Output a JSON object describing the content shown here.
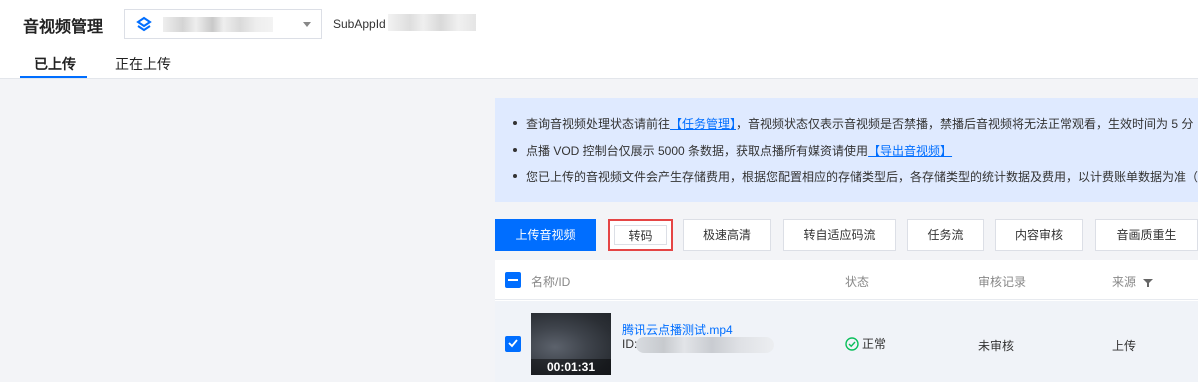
{
  "header": {
    "title": "音视频管理",
    "subapp_label": "SubAppId"
  },
  "tabs": [
    {
      "label": "已上传",
      "active": true
    },
    {
      "label": "正在上传",
      "active": false
    }
  ],
  "notice": {
    "items": [
      {
        "pre": "查询音视频处理状态请前往",
        "link": "【任务管理】",
        "post": "，音视频状态仅表示音视频是否禁播，禁播后音视频将无法正常观看，生效时间为 5 分"
      },
      {
        "pre": "点播 VOD 控制台仅展示 5000 条数据，获取点播所有媒资请使用",
        "link": "【导出音视频】",
        "post": ""
      },
      {
        "pre": "您已上传的音视频文件会产生存储费用，根据您配置相应的存储类型后，各存储类型的统计数据及费用，以计费账单数据为准（",
        "link": "",
        "post": ""
      }
    ]
  },
  "toolbar": {
    "upload": "上传音视频",
    "transcode": "转码",
    "fast_hd": "极速高清",
    "adaptive": "转自适应码流",
    "task_flow": "任务流",
    "content_review": "内容审核",
    "quality_rebuild": "音画质重生"
  },
  "table": {
    "columns": {
      "name": "名称/ID",
      "status": "状态",
      "audit": "审核记录",
      "source": "来源"
    },
    "rows": [
      {
        "duration": "00:01:31",
        "name": "腾讯云点播测试.mp4",
        "id_label": "ID:",
        "status": "正常",
        "audit": "未审核",
        "source": "上传",
        "checked": true
      }
    ]
  },
  "colors": {
    "primary": "#006eff",
    "highlight_border": "#e54545",
    "notice_bg": "#dfeaff",
    "status_ok": "#0abf5b"
  }
}
